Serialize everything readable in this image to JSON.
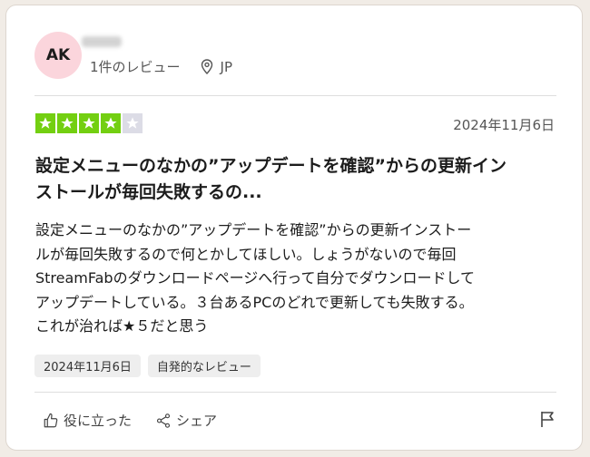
{
  "reviewer": {
    "initials": "AK",
    "review_count": "1件のレビュー",
    "country": "JP"
  },
  "rating": {
    "stars": 4,
    "max": 5
  },
  "review": {
    "date": "2024年11月6日",
    "title_line1": "設定メニューのなかの”アップデートを確認”からの更新イン",
    "title_line2": "ストールが毎回失敗するの...",
    "body_line1": "設定メニューのなかの”アップデートを確認”からの更新インストー",
    "body_line2": "ルが毎回失敗するので何とかしてほしい。しょうがないので毎回",
    "body_line3": "StreamFabのダウンロードページへ行って自分でダウンロードして",
    "body_line4": "アップデートしている。３台あるPCのどれで更新しても失敗する。",
    "body_line5": "これが治れば★５だと思う"
  },
  "tags": {
    "date": "2024年11月6日",
    "unprompted": "自発的なレビュー"
  },
  "actions": {
    "useful": "役に立った",
    "share": "シェア"
  },
  "colors": {
    "star_on": "#73cf11",
    "star_off": "#dcdce6",
    "avatar_bg": "#fbd5dc"
  },
  "icons": {
    "location": "location-pin-icon",
    "useful": "thumbs-up-icon",
    "share": "share-icon",
    "report": "flag-icon",
    "star": "star-icon"
  }
}
